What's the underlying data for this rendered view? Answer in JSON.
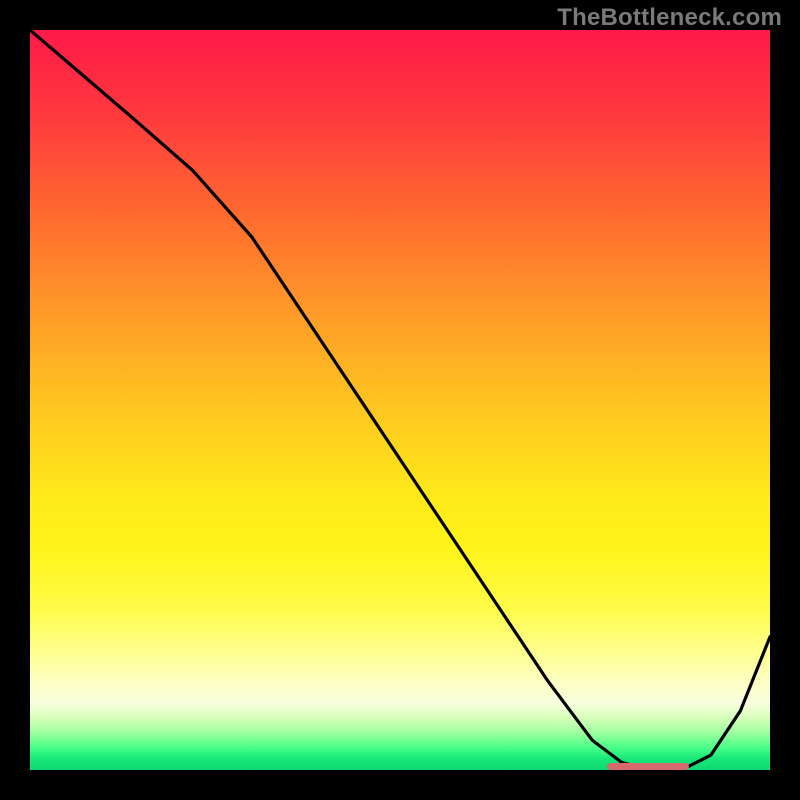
{
  "watermark": "TheBottleneck.com",
  "colors": {
    "background": "#000000",
    "curve_stroke": "#000000",
    "marker": "#d46a6c",
    "watermark_text": "#7a7a7a"
  },
  "chart_data": {
    "type": "line",
    "title": "",
    "xlabel": "",
    "ylabel": "",
    "xlim": [
      0,
      100
    ],
    "ylim": [
      0,
      100
    ],
    "grid": false,
    "series": [
      {
        "name": "bottleneck-curve",
        "x": [
          0,
          7,
          14,
          22,
          30,
          38,
          46,
          54,
          62,
          70,
          76,
          80,
          84,
          88,
          92,
          96,
          100
        ],
        "values": [
          100,
          94,
          88,
          81,
          72,
          60,
          48,
          36,
          24,
          12,
          4,
          1,
          0,
          0,
          2,
          8,
          18
        ]
      }
    ],
    "annotations": [
      {
        "name": "optimal-range-marker",
        "x_start": 78,
        "x_end": 89,
        "y": 0
      }
    ],
    "background_gradient": "red-yellow-green (top→bottom)"
  }
}
